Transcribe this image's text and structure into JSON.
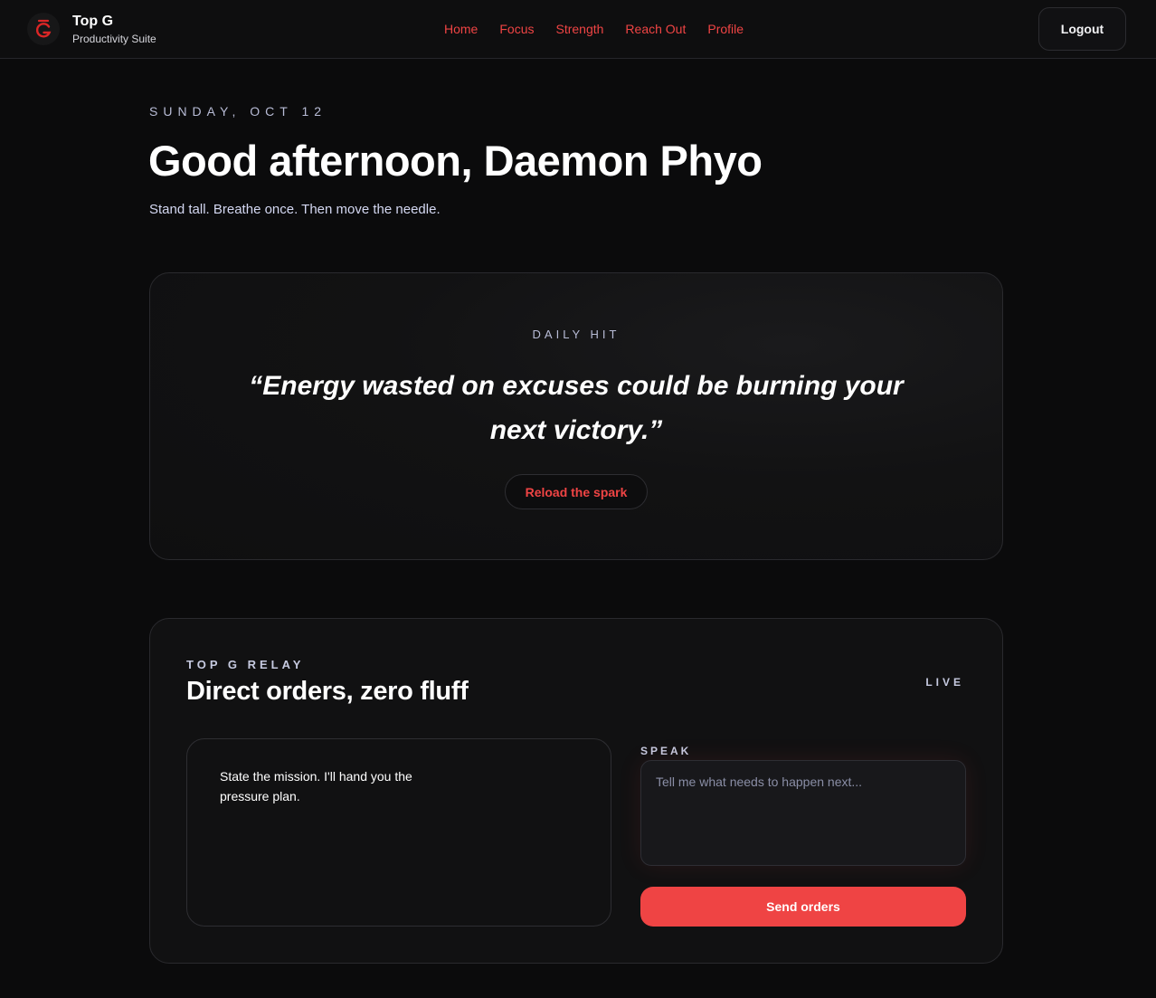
{
  "brand": {
    "title": "Top G",
    "subtitle": "Productivity Suite",
    "accent_color": "#ef4444",
    "logo_icon": "g-shield-icon"
  },
  "nav": {
    "items": [
      {
        "label": "Home"
      },
      {
        "label": "Focus"
      },
      {
        "label": "Strength"
      },
      {
        "label": "Reach Out"
      },
      {
        "label": "Profile"
      }
    ]
  },
  "header": {
    "logout_label": "Logout"
  },
  "greeting": {
    "date": "SUNDAY, OCT 12",
    "headline": "Good afternoon, Daemon Phyo",
    "tagline": "Stand tall. Breathe once. Then move the needle."
  },
  "daily_hit": {
    "label": "DAILY HIT",
    "quote": "“Energy wasted on excuses could be burning your next victory.”",
    "reload_label": "Reload the spark"
  },
  "relay": {
    "label": "TOP G RELAY",
    "title": "Direct orders, zero fluff",
    "status": "LIVE",
    "message": "State the mission. I'll hand you the pressure plan.",
    "speak_label": "SPEAK",
    "input_value": "",
    "input_placeholder": "Tell me what needs to happen next...",
    "send_label": "Send orders"
  },
  "colors": {
    "background": "#0b0b0c",
    "card": "#111112",
    "accent": "#ef4444",
    "muted_label": "#b8bcd6"
  }
}
